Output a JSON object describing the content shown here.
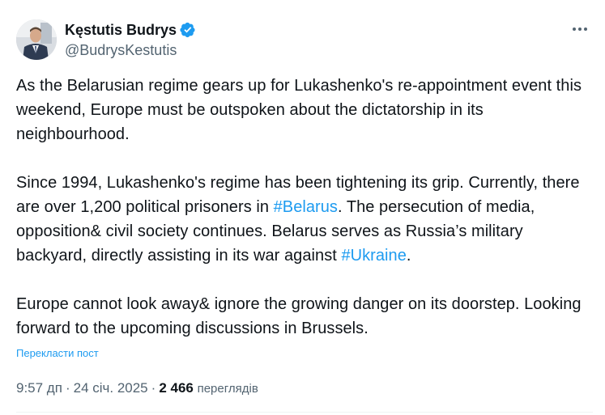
{
  "author": {
    "display_name": "Kęstutis Budrys",
    "handle": "@BudrysKestutis",
    "verified": true,
    "verified_color": "#1d9bf0",
    "avatar_icon": "profile-photo"
  },
  "more_icon": "more-horizontal-icon",
  "tweet": {
    "paragraph_1": "As the Belarusian regime gears up for Lukashenko's re-appointment event this weekend, Europe must be outspoken about the dictatorship in its neighbourhood.",
    "paragraph_2_part_1": "Since 1994, Lukashenko's regime has been tightening its grip. Currently, there are over 1,200 political prisoners in ",
    "hashtag_belarus": "#Belarus",
    "paragraph_2_part_2": ". The persecution of media, opposition& civil society continues. Belarus serves as Russia’s military backyard, directly assisting in its war against ",
    "hashtag_ukraine": "#Ukraine",
    "paragraph_2_part_3": ".",
    "paragraph_3": "Europe cannot look away& ignore the growing danger on its doorstep. Looking forward to the upcoming discussions in Brussels."
  },
  "translate_label": "Перекласти пост",
  "meta": {
    "time": "9:57 дп",
    "separator": "·",
    "date": "24 січ. 2025",
    "views_count": "2 466",
    "views_label": "переглядів"
  },
  "colors": {
    "text_primary": "#0f1419",
    "text_secondary": "#536471",
    "link": "#1d9bf0",
    "divider": "#eff3f4"
  }
}
